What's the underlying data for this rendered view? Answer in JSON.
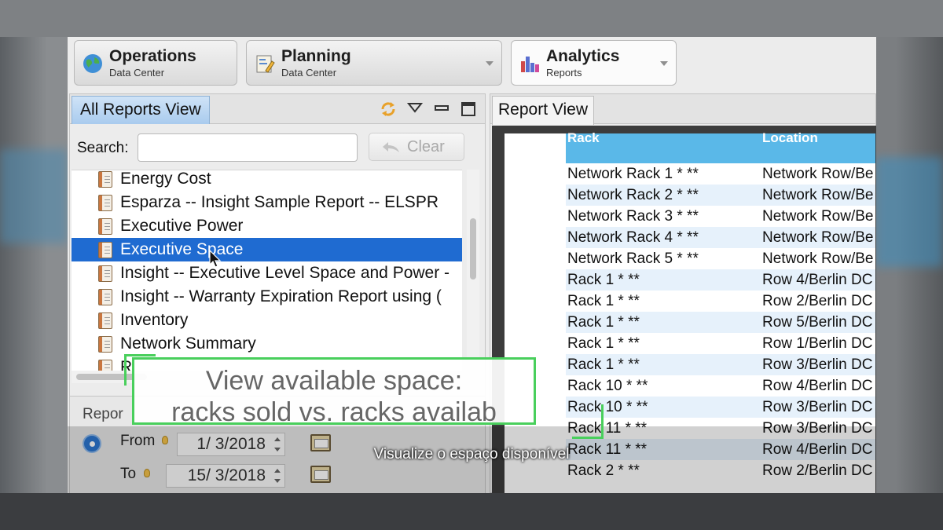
{
  "perspectives": [
    {
      "title": "Operations",
      "subtitle": "Data Center",
      "icon": "globe-icon"
    },
    {
      "title": "Planning",
      "subtitle": "Data Center",
      "icon": "planning-icon"
    },
    {
      "title": "Analytics",
      "subtitle": "Reports",
      "icon": "bar-chart-icon"
    }
  ],
  "left_panel": {
    "tab_label": "All Reports View",
    "search_label": "Search:",
    "search_value": "",
    "clear_label": "Clear",
    "items": [
      "Energy Cost",
      "Esparza -- Insight Sample Report -- ELSPR",
      "Executive Power",
      "Executive Space",
      "Insight -- Executive Level Space and Power -",
      "Insight -- Warranty Expiration Report using (",
      "Inventory",
      "Network Summary",
      "R"
    ],
    "selected_item": "Executive Space"
  },
  "report_params": {
    "header": "Repor",
    "from_label": "From",
    "from_value": "1/ 3/2018",
    "to_label": "To",
    "to_value": "15/ 3/2018"
  },
  "right_panel": {
    "tab_label": "Report View",
    "columns": [
      "Rack",
      "Location"
    ],
    "rows": [
      [
        "Network Rack 1 * **",
        "Network Row/Be"
      ],
      [
        "Network Rack 2 * **",
        "Network Row/Be"
      ],
      [
        "Network Rack 3 * **",
        "Network Row/Be"
      ],
      [
        "Network Rack 4 * **",
        "Network Row/Be"
      ],
      [
        "Network Rack 5 * **",
        "Network Row/Be"
      ],
      [
        "Rack 1 * **",
        "Row 4/Berlin DC"
      ],
      [
        "Rack 1 * **",
        "Row 2/Berlin DC"
      ],
      [
        "Rack 1 * **",
        "Row 5/Berlin DC"
      ],
      [
        "Rack 1 * **",
        "Row 1/Berlin DC"
      ],
      [
        "Rack 1 * **",
        "Row 3/Berlin DC"
      ],
      [
        "Rack 10 * **",
        "Row 4/Berlin DC"
      ],
      [
        "Rack 10 * **",
        "Row 3/Berlin DC"
      ],
      [
        "Rack 11 * **",
        "Row 3/Berlin DC"
      ],
      [
        "Rack 11 * **",
        "Row 4/Berlin DC"
      ],
      [
        "Rack 2 * **",
        "Row 2/Berlin DC"
      ]
    ]
  },
  "callout": {
    "line1": "View available space:",
    "line2": "racks sold vs. racks availab"
  },
  "subtitle": "Visualize o espaço disponível",
  "colors": {
    "selection": "#1f6bd1",
    "report_header": "#5ab8e8",
    "callout_border": "#49cf5c",
    "tab_active": "#a9cbee"
  }
}
